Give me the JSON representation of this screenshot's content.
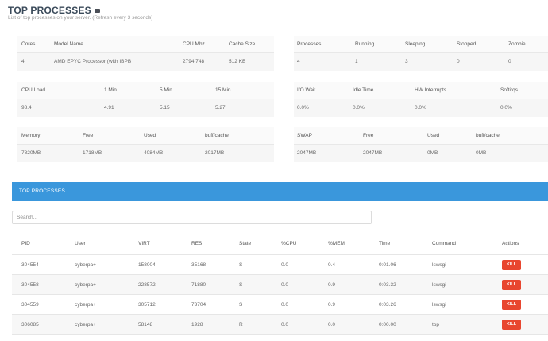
{
  "header": {
    "title": "TOP PROCESSES",
    "subtitle": "List of top processes on your server. (Refresh every 3 seconds)"
  },
  "cpu_info": {
    "headers": [
      "Cores",
      "Model Name",
      "CPU Mhz",
      "Cache Size"
    ],
    "values": [
      "4",
      "AMD EPYC Processor (with IBPB",
      "2794.748",
      "512 KB"
    ]
  },
  "process_counts": {
    "headers": [
      "Processes",
      "Running",
      "Sleeping",
      "Stopped",
      "Zombie"
    ],
    "values": [
      "4",
      "1",
      "3",
      "0",
      "0"
    ]
  },
  "cpu_load": {
    "headers": [
      "CPU Load",
      "1 Min",
      "5 Min",
      "15 Min"
    ],
    "values": [
      "98.4",
      "4.91",
      "5.15",
      "5.27"
    ]
  },
  "io_stats": {
    "headers": [
      "I/O Wait",
      "Idle Time",
      "HW Interrupts",
      "Softirqs"
    ],
    "values": [
      "0.0%",
      "0.0%",
      "0.0%",
      "0.0%"
    ]
  },
  "memory": {
    "headers": [
      "Memory",
      "Free",
      "Used",
      "buff/cache"
    ],
    "values": [
      "7820MB",
      "1718MB",
      "4084MB",
      "2017MB"
    ]
  },
  "swap": {
    "headers": [
      "SWAP",
      "Free",
      "Used",
      "buff/cache"
    ],
    "values": [
      "2047MB",
      "2047MB",
      "0MB",
      "0MB"
    ]
  },
  "processes_section": {
    "title": "TOP PROCESSES",
    "search_placeholder": "Search..."
  },
  "process_table": {
    "columns": [
      "PID",
      "User",
      "VIRT",
      "RES",
      "State",
      "%CPU",
      "%MEM",
      "Time",
      "Command",
      "Actions"
    ],
    "rows": [
      {
        "pid": "304554",
        "user": "cyberpa+",
        "virt": "158004",
        "res": "35168",
        "state": "S",
        "cpu": "0.0",
        "mem": "0.4",
        "time": "0:01.06",
        "command": "lswsgi",
        "action": "KILL"
      },
      {
        "pid": "304558",
        "user": "cyberpa+",
        "virt": "228572",
        "res": "71880",
        "state": "S",
        "cpu": "0.0",
        "mem": "0.9",
        "time": "0:03.32",
        "command": "lswsgi",
        "action": "KILL"
      },
      {
        "pid": "304559",
        "user": "cyberpa+",
        "virt": "305712",
        "res": "73704",
        "state": "S",
        "cpu": "0.0",
        "mem": "0.9",
        "time": "0:03.26",
        "command": "lswsgi",
        "action": "KILL"
      },
      {
        "pid": "306085",
        "user": "cyberpa+",
        "virt": "58148",
        "res": "1928",
        "state": "R",
        "cpu": "0.0",
        "mem": "0.0",
        "time": "0:00.00",
        "command": "top",
        "action": "KILL"
      }
    ]
  },
  "colors": {
    "accent_bar": "#3a97dc",
    "kill_button": "#e8462f"
  }
}
